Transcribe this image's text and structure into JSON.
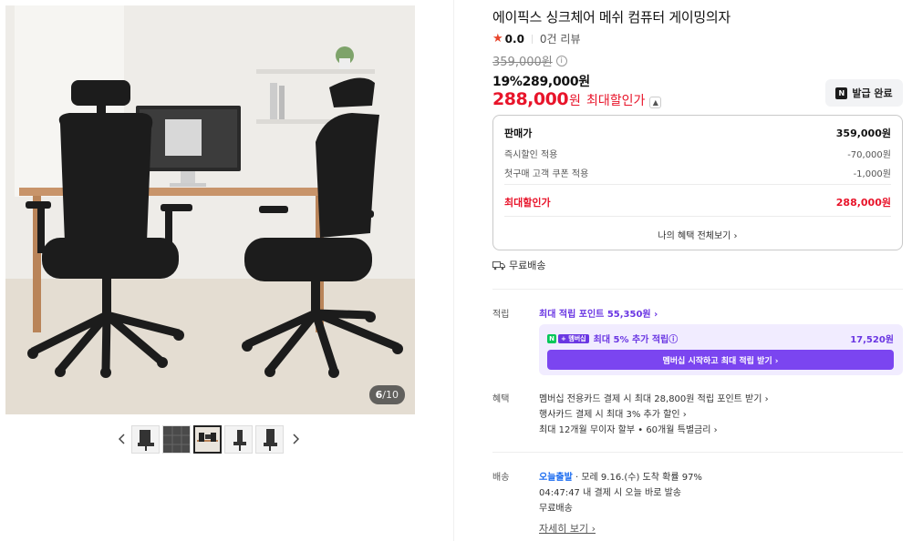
{
  "gallery": {
    "counter_current": "6",
    "counter_sep": "/",
    "counter_total": "10",
    "thumb_count": 5,
    "active_thumb": 2
  },
  "product": {
    "title": "에이픽스 싱크체어 메쉬 컴퓨터 게이밍의자",
    "rating": "0.0",
    "review_count": "0건 리뷰",
    "original_price": "359,000원",
    "discount_line": "19%289,000원",
    "max_price": "288,000",
    "max_price_unit": "원",
    "max_price_label": "최대할인가",
    "coupon_button": "발급 완료"
  },
  "price_box": {
    "rows": [
      {
        "label": "판매가",
        "value": "359,000원"
      },
      {
        "label": "즉시할인 적용",
        "value": "-70,000원"
      },
      {
        "label": "첫구매 고객 쿠폰 적용",
        "value": "-1,000원"
      },
      {
        "label": "최대할인가",
        "value": "288,000원"
      }
    ],
    "more_link": "나의 혜택 전체보기 ›"
  },
  "shipping_free": "무료배송",
  "points": {
    "label": "적립",
    "max_link": "최대 적립 포인트 55,350원 ›",
    "badge_n": "N",
    "badge_plus": "+ 멤버십",
    "extra": "최대 5% 추가 적립ⓘ",
    "extra_value": "17,520원",
    "cta": "멤버십 시작하고 최대 적립 받기 ›"
  },
  "benefits": {
    "label": "혜택",
    "items": [
      "멤버십 전용카드 결제 시 최대 28,800원 적립 포인트 받기 ›",
      "행사카드 결제 시 최대 3% 추가 할인 ›",
      "최대 12개월 무이자 할부 • 60개월 특별금리 ›"
    ]
  },
  "delivery": {
    "label": "배송",
    "today": "오늘출발",
    "eta": " · 모레 9.16.(수) 도착 확률 97%",
    "deadline": "04:47:47  내 결제 시 오늘 바로 발송",
    "free": "무료배송",
    "detail_link": "자세히 보기 ›"
  },
  "colors": {
    "accent_red": "#e8142a",
    "accent_purple": "#6a36e3",
    "accent_blue": "#1b6cf0"
  }
}
